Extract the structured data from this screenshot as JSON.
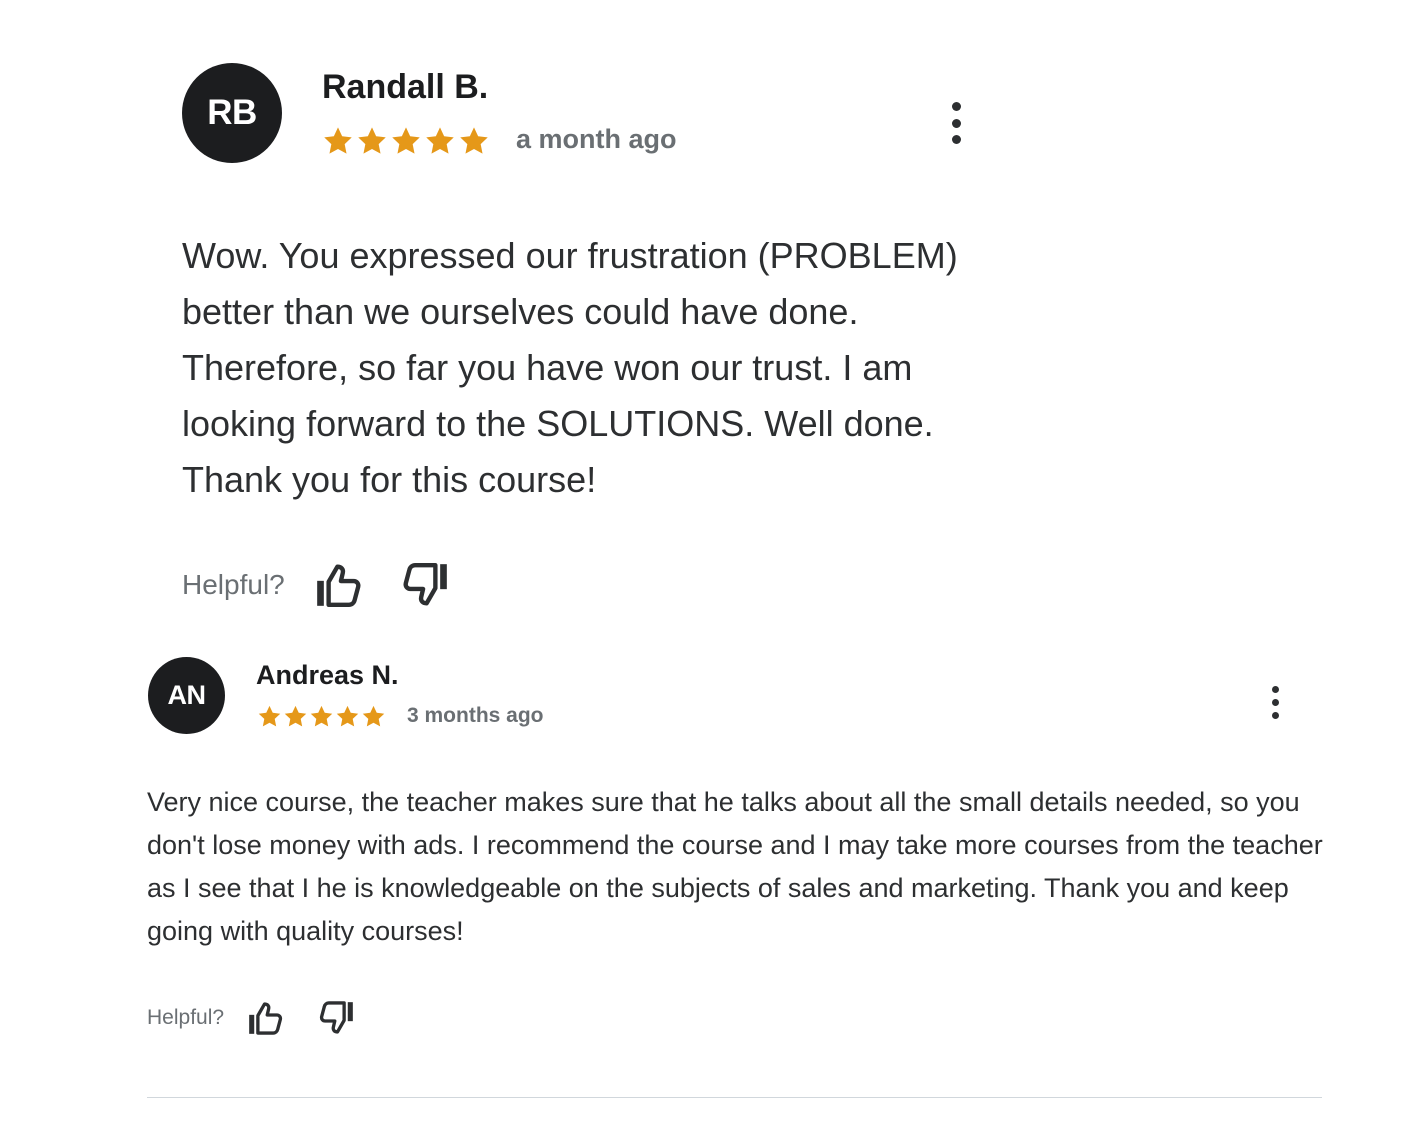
{
  "reviews": [
    {
      "initials": "RB",
      "name": "Randall B.",
      "rating": 5,
      "time_ago": "a month ago",
      "content": "Wow. You expressed our frustration (PROBLEM) better than we ourselves could have done. Therefore, so far you have won our trust. I am looking forward to the SOLUTIONS. Well done. Thank you for this course!",
      "helpful_label": "Helpful?"
    },
    {
      "initials": "AN",
      "name": "Andreas N.",
      "rating": 5,
      "time_ago": "3 months ago",
      "content": "Very nice course, the teacher makes sure that he talks about all the small details needed, so you don't lose money with ads. I recommend the course and I may take more courses from the teacher as I see that I he is knowledgeable on the subjects of sales and marketing. Thank you and keep going with quality courses!",
      "helpful_label": "Helpful?"
    }
  ],
  "colors": {
    "star": "#e59819",
    "avatar_bg": "#1c1d1f",
    "text": "#2d2f31",
    "muted": "#6a6f73",
    "divider": "#d1d7dc"
  },
  "icons": {
    "more": "more-vertical-icon",
    "star": "star-icon",
    "thumbs_up": "thumbs-up-icon",
    "thumbs_down": "thumbs-down-icon"
  }
}
